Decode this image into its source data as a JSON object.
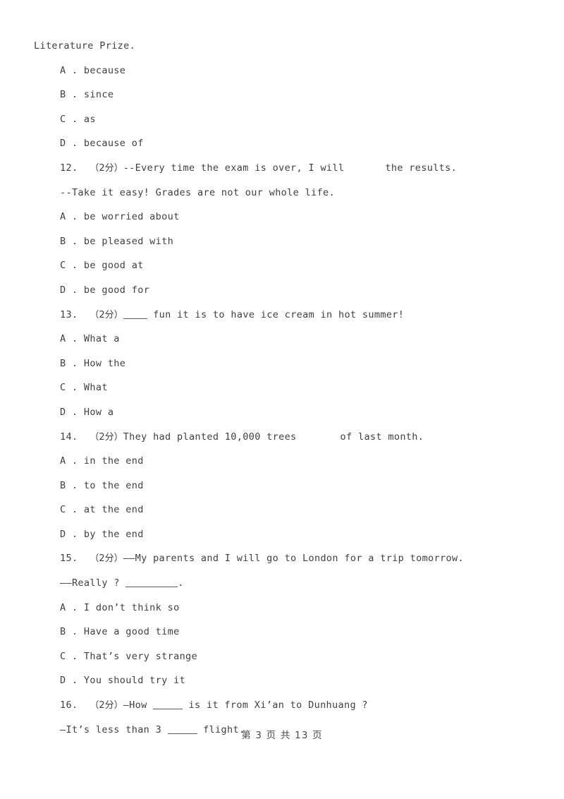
{
  "document": {
    "type": "exam-worksheet",
    "language": "en-zh",
    "background_color": "#ffffff",
    "text_color": "#3f3f3f"
  },
  "continuation": {
    "text": "Literature Prize."
  },
  "previous_question_options": [
    {
      "letter": "A",
      "sep": " . ",
      "text": "because"
    },
    {
      "letter": "B",
      "sep": " . ",
      "text": "since"
    },
    {
      "letter": "C",
      "sep": " . ",
      "text": "as"
    },
    {
      "letter": "D",
      "sep": " . ",
      "text": "because of"
    }
  ],
  "questions": [
    {
      "number": "12.",
      "score": "（2分）",
      "stem_before": "--Every time the exam is over, I will",
      "stem_after": "the results.",
      "second_line": "--Take it easy! Grades are not our whole life.",
      "options": [
        {
          "letter": "A",
          "sep": " . ",
          "text": "be worried about"
        },
        {
          "letter": "B",
          "sep": " . ",
          "text": "be pleased with"
        },
        {
          "letter": "C",
          "sep": " . ",
          "text": "be good at"
        },
        {
          "letter": "D",
          "sep": " . ",
          "text": "be good for"
        }
      ]
    },
    {
      "number": "13.",
      "score": "（2分）",
      "stem_before": "",
      "stem_after": "fun it is to have ice cream in hot summer!",
      "second_line": "",
      "options": [
        {
          "letter": "A",
          "sep": " . ",
          "text": "What a"
        },
        {
          "letter": "B",
          "sep": " . ",
          "text": "How the"
        },
        {
          "letter": "C",
          "sep": " . ",
          "text": "What"
        },
        {
          "letter": "D",
          "sep": " . ",
          "text": "How a"
        }
      ]
    },
    {
      "number": "14.",
      "score": "（2分）",
      "stem_before": "They had planted 10,000 trees",
      "stem_after": "of last month.",
      "second_line": "",
      "options": [
        {
          "letter": "A",
          "sep": " . ",
          "text": "in the end"
        },
        {
          "letter": "B",
          "sep": " . ",
          "text": "to the end"
        },
        {
          "letter": "C",
          "sep": " . ",
          "text": "at the end"
        },
        {
          "letter": "D",
          "sep": " . ",
          "text": "by the end"
        }
      ]
    },
    {
      "number": "15.",
      "score": "（2分）",
      "stem_before": "——My parents and I will go to London for a trip tomorrow.",
      "stem_after": "",
      "second_line_before": "——Really ? ",
      "second_line_after": ".",
      "options": [
        {
          "letter": "A",
          "sep": " . ",
          "text": "I don’t think so"
        },
        {
          "letter": "B",
          "sep": " . ",
          "text": "Have a good time"
        },
        {
          "letter": "C",
          "sep": " . ",
          "text": "That’s very strange"
        },
        {
          "letter": "D",
          "sep": " . ",
          "text": "You should try it"
        }
      ]
    },
    {
      "number": "16.",
      "score": "（2分）",
      "stem_before": "—How ",
      "stem_after": " is it from Xi’an to Dunhuang ?",
      "second_line_before": "—It’s less than 3 ",
      "second_line_after": " flight.",
      "options": []
    }
  ],
  "footer": {
    "text": "第 3 页 共 13 页",
    "page_number": "3",
    "total_pages": "13"
  }
}
